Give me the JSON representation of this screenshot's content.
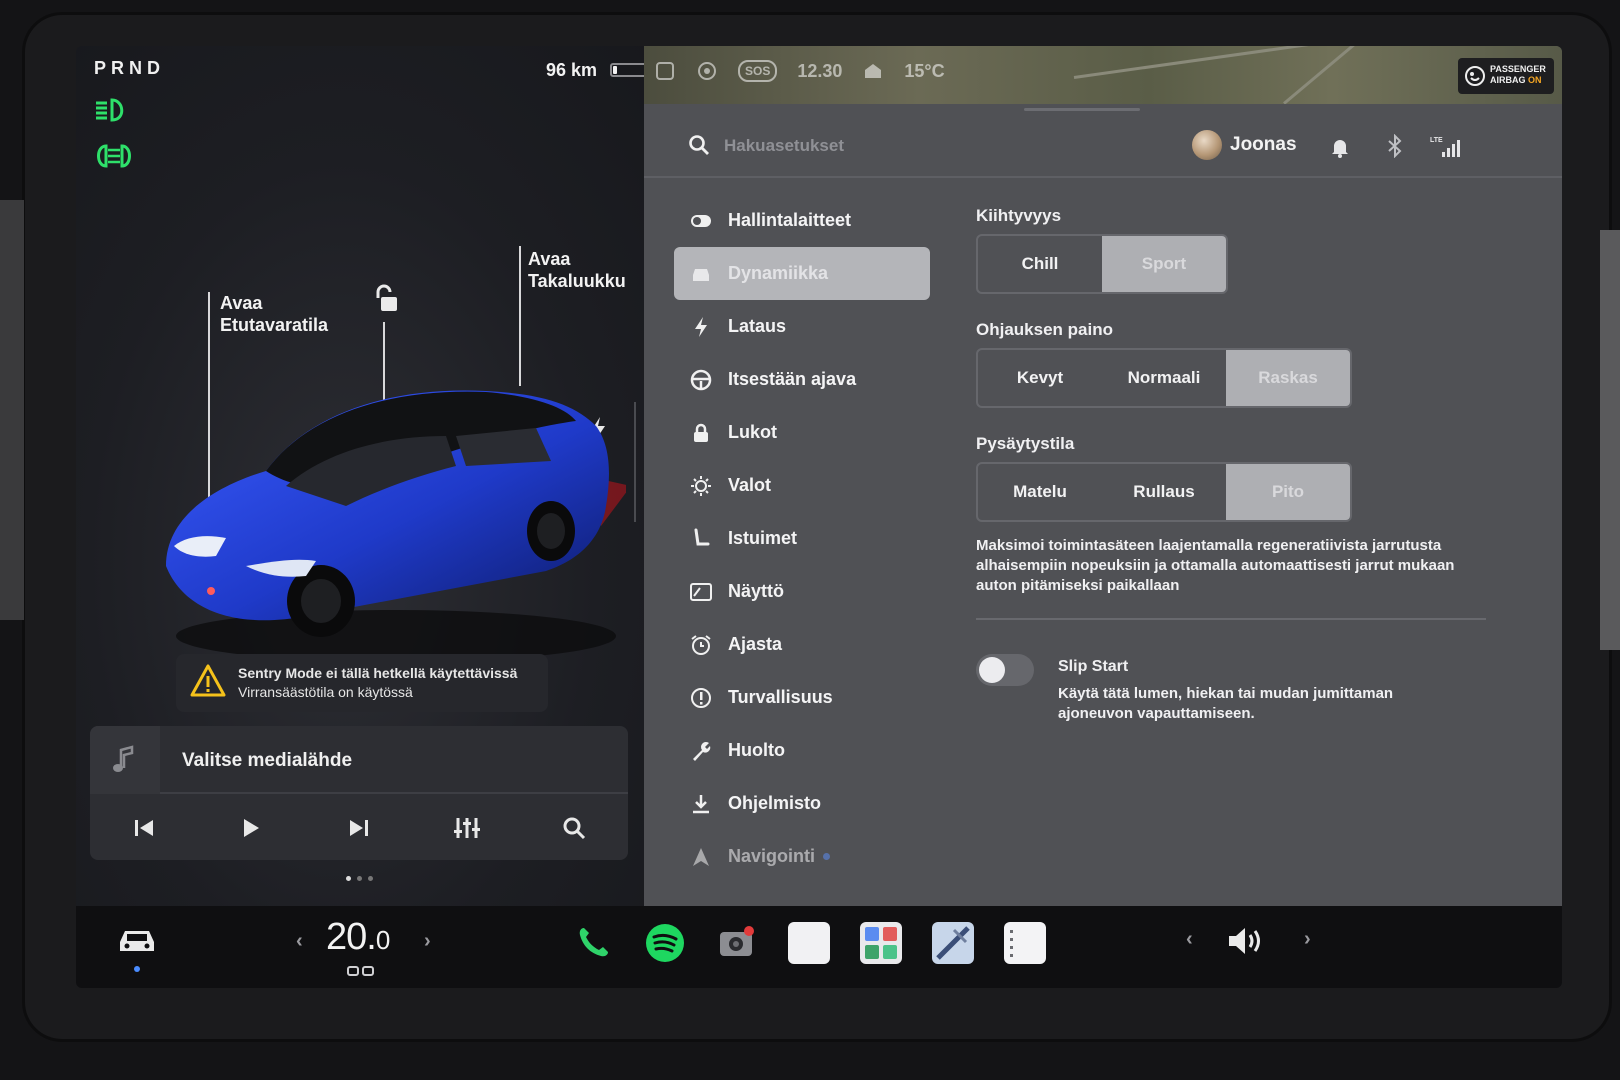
{
  "drive": {
    "gear_selector": "PRND",
    "range": "96 km",
    "battery_level": 0.12
  },
  "car": {
    "frunk_label": "Avaa\nEtutavaratila",
    "trunk_label": "Avaa\nTakaluukku",
    "sentry_title": "Sentry Mode ei tällä hetkellä käytettävissä",
    "sentry_sub": "Virransäästötila on käytössä"
  },
  "media": {
    "source_label": "Valitse medialähde",
    "controls": [
      "previous-icon",
      "play-icon",
      "next-icon",
      "equalizer-icon",
      "search-icon"
    ]
  },
  "status_bar": {
    "sos": "SOS",
    "time": "12.30",
    "temperature": "15°C",
    "airbag_line1": "PASSENGER",
    "airbag_line2": "AIRBAG",
    "airbag_state": "ON"
  },
  "header": {
    "search_placeholder": "Hakuasetukset",
    "user_name": "Joonas",
    "network": "LTE"
  },
  "menu": {
    "items": [
      {
        "label": "Hallintalaitteet",
        "icon": "toggle-icon"
      },
      {
        "label": "Dynamiikka",
        "icon": "car-front-icon",
        "active": true
      },
      {
        "label": "Lataus",
        "icon": "bolt-icon"
      },
      {
        "label": "Itsestään ajava",
        "icon": "steering-wheel-icon"
      },
      {
        "label": "Lukot",
        "icon": "lock-icon"
      },
      {
        "label": "Valot",
        "icon": "sun-icon"
      },
      {
        "label": "Istuimet",
        "icon": "seat-icon"
      },
      {
        "label": "Näyttö",
        "icon": "display-icon"
      },
      {
        "label": "Ajasta",
        "icon": "alarm-clock-icon"
      },
      {
        "label": "Turvallisuus",
        "icon": "info-circle-icon"
      },
      {
        "label": "Huolto",
        "icon": "wrench-icon"
      },
      {
        "label": "Ohjelmisto",
        "icon": "download-icon"
      },
      {
        "label": "Navigointi",
        "icon": "navigation-icon"
      }
    ]
  },
  "dynamics": {
    "acceleration": {
      "title": "Kiihtyvyys",
      "options": [
        "Chill",
        "Sport"
      ],
      "selected": "Sport"
    },
    "steering": {
      "title": "Ohjauksen paino",
      "options": [
        "Kevyt",
        "Normaali",
        "Raskas"
      ],
      "selected": "Raskas"
    },
    "stopping": {
      "title": "Pysäytystila",
      "options": [
        "Matelu",
        "Rullaus",
        "Pito"
      ],
      "selected": "Pito",
      "description": "Maksimoi toimintasäteen laajentamalla regeneratiivista jarrutusta alhaisempiin nopeuksiin ja ottamalla automaattisesti jarrut mukaan auton pitämiseksi paikallaan"
    },
    "slip_start": {
      "title": "Slip Start",
      "description": "Käytä tätä lumen, hiekan tai mudan jumittaman ajoneuvon vapauttamiseen.",
      "enabled": false
    }
  },
  "dock": {
    "temperature_main": "20.",
    "temperature_decimal": "0",
    "apps": [
      "phone-icon",
      "spotify-icon",
      "camera-icon",
      "blank-app-icon",
      "app-launcher-icon",
      "browser-icon",
      "notes-icon"
    ]
  },
  "colors": {
    "active_menu": "#b4b5b9",
    "selected_segment": "#aeafb3",
    "light_indicator": "#2ee06a",
    "warning": "#f5c21b",
    "nav_dot": "#5b8cf0",
    "car_body": "#1f3ac9"
  }
}
